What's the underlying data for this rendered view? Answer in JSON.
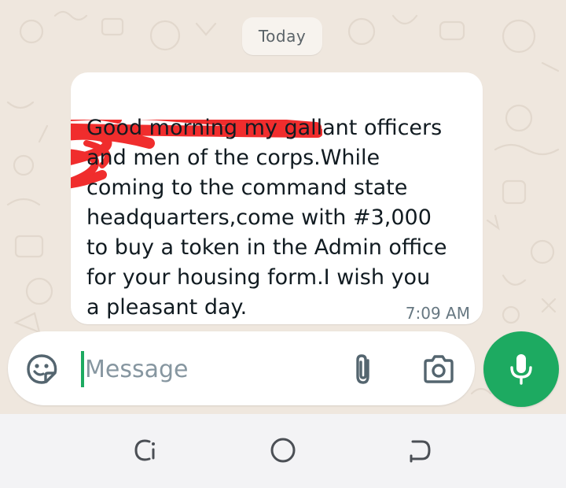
{
  "chat": {
    "date_label": "Today",
    "message": {
      "sender": "",
      "text": "Good morning my gallant officers\nand men of the corps.While\ncoming to the command state\nheadquarters,come with #3,000\nto buy a token in the Admin office\nfor your housing form.I wish you\na pleasant day.",
      "time": "7:09 AM",
      "sender_redacted": true
    }
  },
  "composer": {
    "placeholder": "Message",
    "value": "",
    "icons": {
      "sticker": "sticker-icon",
      "attach": "paperclip-icon",
      "camera": "camera-icon",
      "mic": "microphone-icon"
    }
  },
  "navbar": {
    "icons": [
      "recents-icon",
      "home-icon",
      "back-icon"
    ]
  },
  "colors": {
    "wallpaper": "#efe7de",
    "bubble": "#ffffff",
    "accent_green": "#1daa61",
    "redaction_red": "#f02d2d",
    "navbar_bg": "#f3f3f5"
  }
}
